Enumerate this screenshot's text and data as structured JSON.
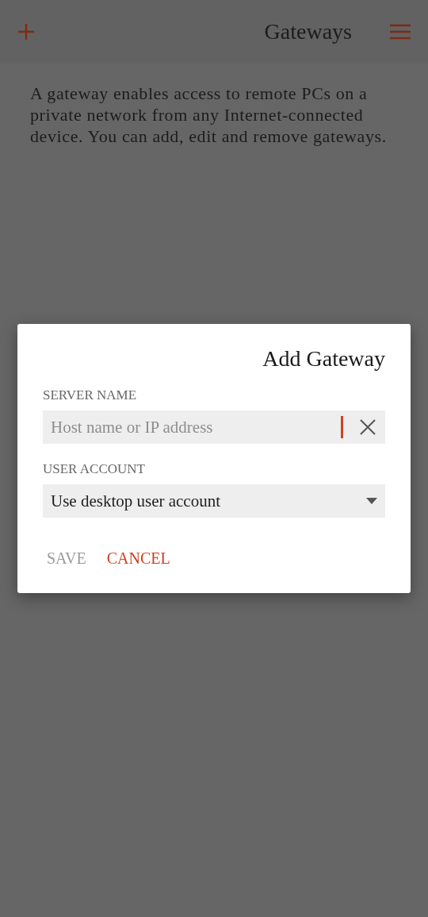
{
  "header": {
    "title": "Gateways"
  },
  "description": "A gateway enables access to remote PCs on a private network from any Internet-connected device. You can add, edit and remove gateways.",
  "dialog": {
    "title": "Add Gateway",
    "fields": [
      {
        "kind": "text",
        "label": "SERVER NAME",
        "placeholder": "Host name or IP address",
        "focused": true
      },
      {
        "kind": "select",
        "label": "USER ACCOUNT",
        "value": "Use desktop user account"
      }
    ],
    "buttons": [
      {
        "label": "SAVE",
        "disabled": true
      },
      {
        "label": "CANCEL",
        "disabled": false
      }
    ]
  }
}
